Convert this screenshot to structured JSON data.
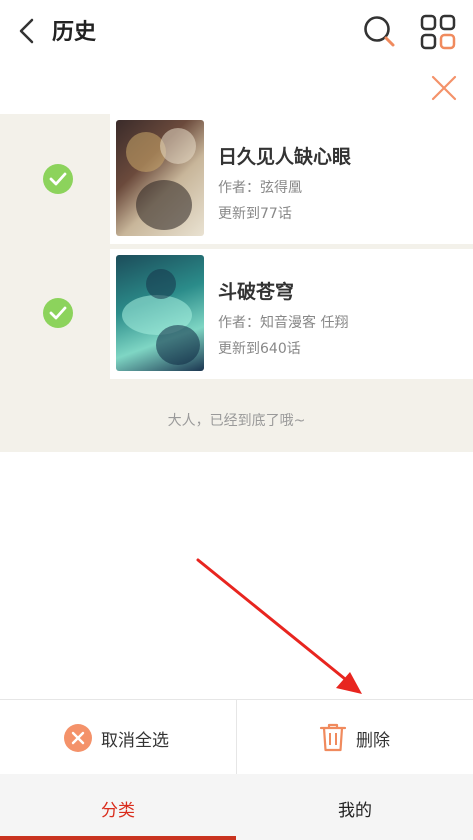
{
  "header": {
    "title": "历史",
    "back_icon": "chevron-left-icon",
    "search_icon": "search-icon",
    "grid_icon": "grid-icon",
    "close_icon": "close-icon"
  },
  "history": {
    "items": [
      {
        "name": "日久见人缺心眼",
        "author": "作者：弦得凰",
        "update": "更新到77话",
        "checked": true
      },
      {
        "name": "斗破苍穹",
        "author": "作者：知音漫客 任翔",
        "update": "更新到640话",
        "checked": true
      }
    ],
    "end_note": "大人，已经到底了哦~"
  },
  "actions": {
    "cancel_all_label": "取消全选",
    "delete_label": "删除"
  },
  "tabs": [
    {
      "label": "分类",
      "active": true
    },
    {
      "label": "我的",
      "active": false
    }
  ],
  "colors": {
    "accent": "#d92c1c",
    "check": "#8cd35c",
    "orange": "#f4926a",
    "list_bg": "#f3f1ea"
  }
}
